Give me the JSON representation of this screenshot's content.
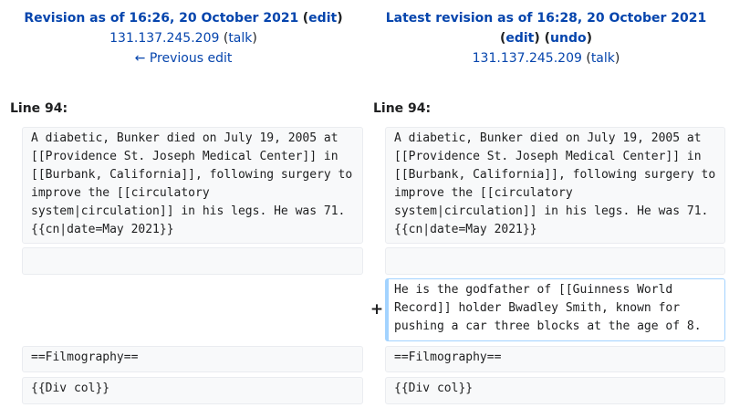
{
  "left_header": {
    "title_prefix": "Revision as of 16:26, 20 October 2021",
    "edit_link": "edit",
    "user": "131.137.245.209",
    "talk_link": "talk",
    "prev_edit": "← Previous edit"
  },
  "right_header": {
    "title_prefix": "Latest revision as of 16:28, 20 October 2021",
    "edit_link": "edit",
    "undo_link": "undo",
    "user": "131.137.245.209",
    "talk_link": "talk"
  },
  "line_label_left": "Line 94:",
  "line_label_right": "Line 94:",
  "diff": {
    "context1": "A diabetic, Bunker died on July 19, 2005 at [[Providence St. Joseph Medical Center]] in [[Burbank, California]], following surgery to improve the [[circulatory system|circulation]] in his legs. He was 71. {{cn|date=May 2021}}",
    "empty": "",
    "added_marker": "+",
    "added": "He is the godfather of [[Guinness World Record]] holder Bwadley Smith, known for pushing a car three blocks at the age of 8.",
    "context2": "==Filmography==",
    "context3": "{{Div col}}"
  },
  "colors": {
    "link": "#0645ad",
    "context_bg": "#f8f9fa",
    "context_border": "#eaecf0",
    "added_border": "#a3d3ff"
  }
}
